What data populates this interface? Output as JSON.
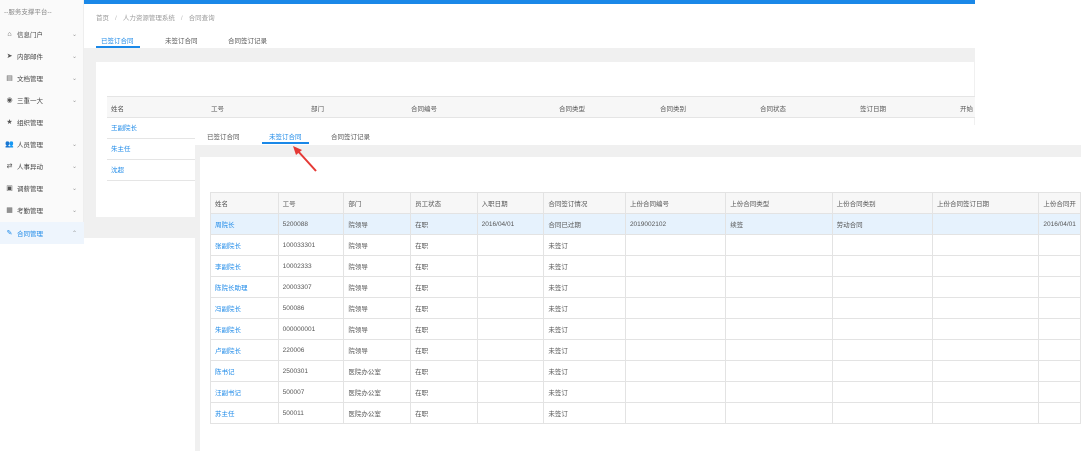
{
  "sidebar": {
    "title": "--服务支撑平台--",
    "items": [
      {
        "icon": "dashboard-icon",
        "glyph": "⌂",
        "label": "信息门户",
        "expandable": true
      },
      {
        "icon": "send-icon",
        "glyph": "➤",
        "label": "内部邮件",
        "expandable": true
      },
      {
        "icon": "document-icon",
        "glyph": "▤",
        "label": "文档管理",
        "expandable": true
      },
      {
        "icon": "target-icon",
        "glyph": "◉",
        "label": "三重一大",
        "expandable": true
      },
      {
        "icon": "star-icon",
        "glyph": "★",
        "label": "组织管理",
        "expandable": false
      },
      {
        "icon": "users-icon",
        "glyph": "👥",
        "label": "人员管理",
        "expandable": true
      },
      {
        "icon": "user-change-icon",
        "glyph": "⇄",
        "label": "人事异动",
        "expandable": true
      },
      {
        "icon": "lock-icon",
        "glyph": "▣",
        "label": "调薪管理",
        "expandable": true
      },
      {
        "icon": "calendar-icon",
        "glyph": "▦",
        "label": "考勤管理",
        "expandable": true
      },
      {
        "icon": "pin-icon",
        "glyph": "✎",
        "label": "合同管理",
        "expandable": true,
        "active": true
      }
    ]
  },
  "breadcrumb": [
    "首页",
    "人力资源管理系统",
    "合同查询"
  ],
  "back_tabs": [
    "已签订合同",
    "未签订合同",
    "合同签订记录"
  ],
  "back_table": {
    "headers": [
      "姓名",
      "工号",
      "部门",
      "合同编号",
      "合同类型",
      "合同类别",
      "合同状态",
      "签订日期",
      "开始"
    ],
    "rows": [
      "王副院长",
      "朱主任",
      "沈超"
    ]
  },
  "front_tabs": [
    "已签订合同",
    "未签订合同",
    "合同签订记录"
  ],
  "front_active_tab": 1,
  "table": {
    "headers": [
      "姓名",
      "工号",
      "部门",
      "员工状态",
      "入职日期",
      "合同签订情况",
      "上份合同编号",
      "上份合同类型",
      "上份合同类别",
      "上份合同签订日期",
      "上份合同开"
    ],
    "rows": [
      [
        "周院长",
        "5200088",
        "院领导",
        "在职",
        "2016/04/01",
        "合同已过期",
        "2019002102",
        "续签",
        "劳动合同",
        "",
        "2016/04/01"
      ],
      [
        "张副院长",
        "100033301",
        "院领导",
        "在职",
        "",
        "未签订",
        "",
        "",
        "",
        "",
        ""
      ],
      [
        "李副院长",
        "10002333",
        "院领导",
        "在职",
        "",
        "未签订",
        "",
        "",
        "",
        "",
        ""
      ],
      [
        "陈院长助理",
        "20003307",
        "院领导",
        "在职",
        "",
        "未签订",
        "",
        "",
        "",
        "",
        ""
      ],
      [
        "冯副院长",
        "500086",
        "院领导",
        "在职",
        "",
        "未签订",
        "",
        "",
        "",
        "",
        ""
      ],
      [
        "朱副院长",
        "000000001",
        "院领导",
        "在职",
        "",
        "未签订",
        "",
        "",
        "",
        "",
        ""
      ],
      [
        "卢副院长",
        "220006",
        "院领导",
        "在职",
        "",
        "未签订",
        "",
        "",
        "",
        "",
        ""
      ],
      [
        "陈书记",
        "2500301",
        "医院办公室",
        "在职",
        "",
        "未签订",
        "",
        "",
        "",
        "",
        ""
      ],
      [
        "汪副书记",
        "500007",
        "医院办公室",
        "在职",
        "",
        "未签订",
        "",
        "",
        "",
        "",
        ""
      ],
      [
        "苏主任",
        "500011",
        "医院办公室",
        "在职",
        "",
        "未签订",
        "",
        "",
        "",
        "",
        ""
      ]
    ]
  },
  "colors": {
    "accent": "#1a88e8",
    "highlight_row": "#e6f2fd",
    "arrow": "#e53935"
  }
}
